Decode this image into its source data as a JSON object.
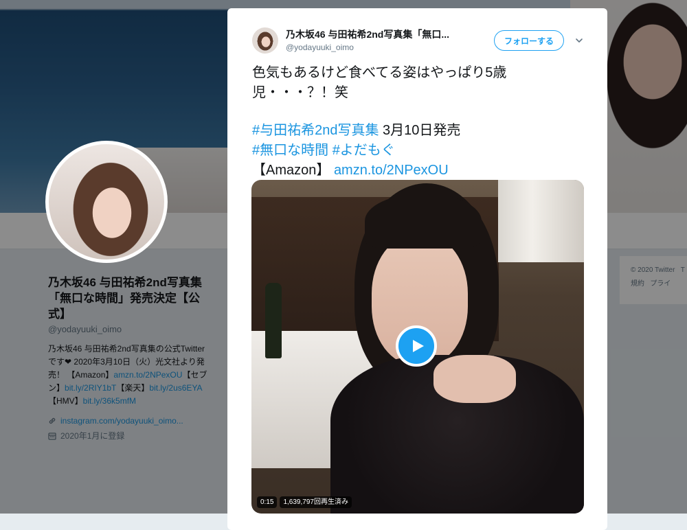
{
  "background": {
    "profile": {
      "name": "乃木坂46 与田祐希2nd写真集「無口な時間」発売決定【公式】",
      "handle": "@yodayuuki_oimo",
      "bio": {
        "line1": "乃木坂46 与田祐希2nd写真集の公式Twitterです❤ 2020年3月10日（火）光文社より発売！",
        "amazon_label": "【Amazon】",
        "amazon_link": "amzn.to/2NPexOU",
        "seven_label": "【セブン】",
        "seven_link": "bit.ly/2RIY1bT",
        "rakuten_label": "【楽天】",
        "rakuten_link": "bit.ly/2us6EYA",
        "hmv_label": "【HMV】",
        "hmv_link": "bit.ly/36k5mfM"
      },
      "website": "instagram.com/yodayuuki_oimo...",
      "joined": "2020年1月に登録"
    },
    "footer": {
      "copyright": "© 2020 Twitter",
      "copyright_extra": "T",
      "terms": "規約",
      "privacy": "プライ"
    }
  },
  "tweet": {
    "author_name": "乃木坂46 与田祐希2nd写真集「無口...",
    "author_handle": "@yodayuuki_oimo",
    "follow_label": "フォローする",
    "text_line1": "色気もあるけど食べてる姿はやっぱり5歳児・・・？！笑",
    "hashtag1": "#与田祐希2nd写真集",
    "release": " 3月10日発売",
    "hashtag2": "#無口な時間",
    "hashtag3": "#よだもぐ",
    "amazon_label": "【Amazon】",
    "amazon_link": "amzn.to/2NPexOU",
    "video": {
      "duration": "0:15",
      "views": "1,639,797回再生済み"
    }
  },
  "colors": {
    "accent": "#1da1f2",
    "link": "#1b95e0",
    "overlay": "rgba(0,0,0,0.45)"
  },
  "icons": [
    "caret-down-icon",
    "play-icon",
    "link-icon",
    "calendar-icon"
  ]
}
